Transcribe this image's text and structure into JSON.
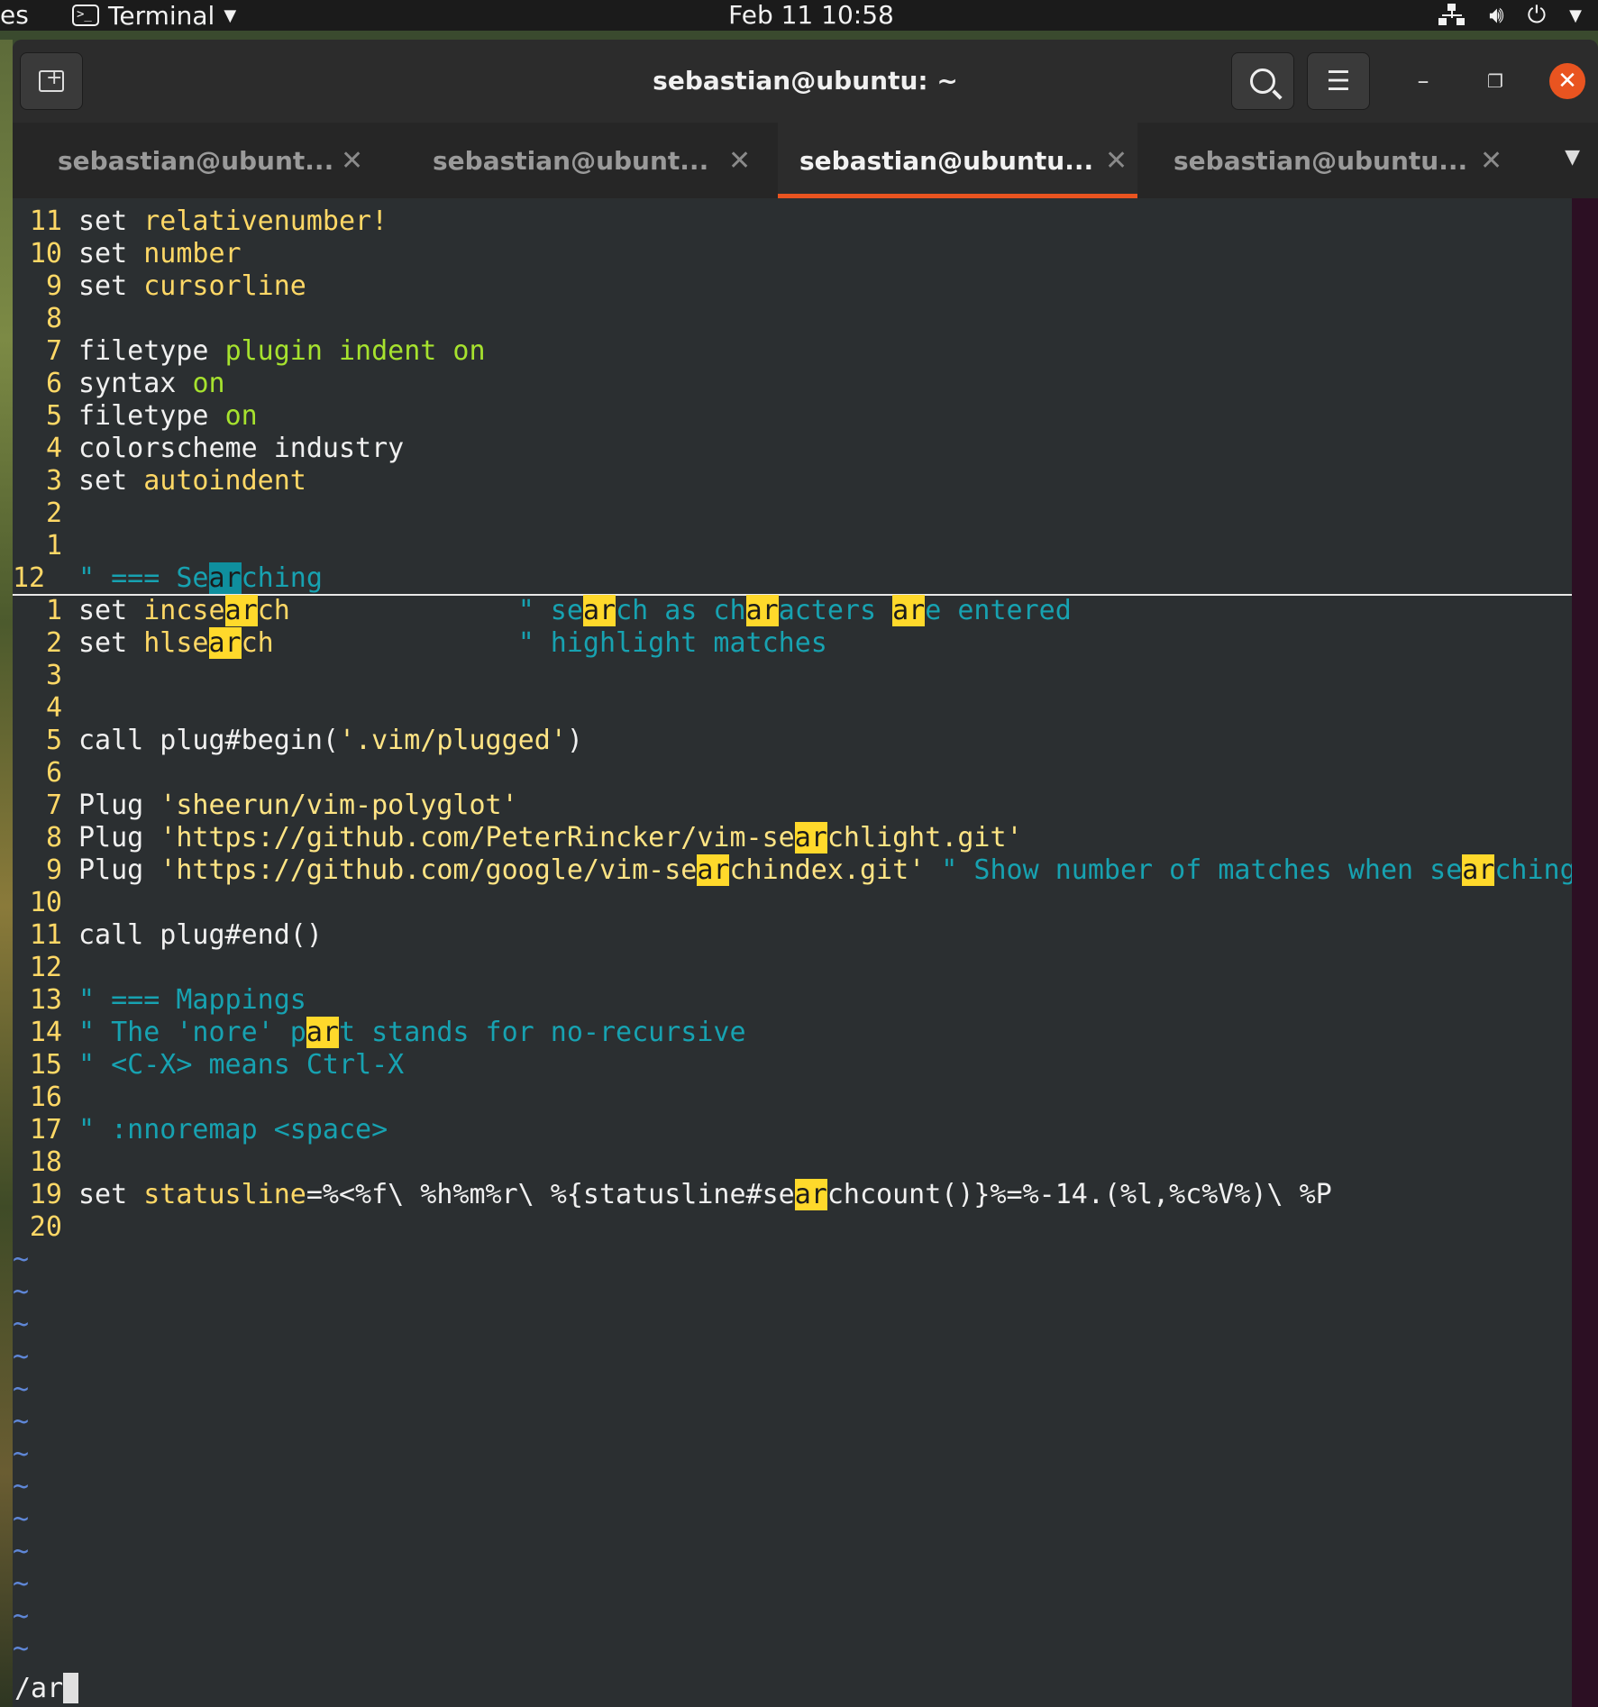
{
  "topbar": {
    "activities": "es",
    "app_name": "Terminal",
    "clock": "Feb 11  10:58"
  },
  "window": {
    "title": "sebastian@ubuntu: ~"
  },
  "tabs": [
    {
      "label": "sebastian@ubunt..."
    },
    {
      "label": "sebastian@ubunt..."
    },
    {
      "label": "sebastian@ubuntu..."
    },
    {
      "label": "sebastian@ubuntu..."
    }
  ],
  "vim": {
    "lines": [
      {
        "n": "11",
        "segs": [
          [
            "set ",
            "w"
          ],
          [
            "relativenumber!",
            "o"
          ]
        ]
      },
      {
        "n": "10",
        "segs": [
          [
            "set ",
            "w"
          ],
          [
            "number",
            "o"
          ]
        ]
      },
      {
        "n": "9",
        "segs": [
          [
            "set ",
            "w"
          ],
          [
            "cursorline",
            "o"
          ]
        ]
      },
      {
        "n": "8",
        "segs": []
      },
      {
        "n": "7",
        "segs": [
          [
            "filetype ",
            "w"
          ],
          [
            "plugin indent on",
            "g"
          ]
        ]
      },
      {
        "n": "6",
        "segs": [
          [
            "syntax ",
            "w"
          ],
          [
            "on",
            "g"
          ]
        ]
      },
      {
        "n": "5",
        "segs": [
          [
            "filetype ",
            "w"
          ],
          [
            "on",
            "g"
          ]
        ]
      },
      {
        "n": "4",
        "segs": [
          [
            "colorscheme ",
            "w"
          ],
          [
            "industry",
            "t"
          ]
        ]
      },
      {
        "n": "3",
        "segs": [
          [
            "set ",
            "w"
          ],
          [
            "autoindent",
            "o"
          ]
        ]
      },
      {
        "n": "2",
        "segs": []
      },
      {
        "n": "1",
        "segs": []
      },
      {
        "n": "12",
        "cur": true,
        "segs": [
          [
            "\" === Se",
            "c"
          ],
          [
            "ar",
            "hc"
          ],
          [
            "ching",
            "c"
          ]
        ]
      },
      {
        "n": "1",
        "segs": [
          [
            "set ",
            "w"
          ],
          [
            "incse",
            "o"
          ],
          [
            "ar",
            "h"
          ],
          [
            "ch",
            "o"
          ],
          [
            "              ",
            "w"
          ],
          [
            "\" se",
            "c"
          ],
          [
            "ar",
            "h"
          ],
          [
            "ch as ch",
            "c"
          ],
          [
            "ar",
            "h"
          ],
          [
            "acters ",
            "c"
          ],
          [
            "ar",
            "h"
          ],
          [
            "e entered",
            "c"
          ]
        ]
      },
      {
        "n": "2",
        "segs": [
          [
            "set ",
            "w"
          ],
          [
            "hlse",
            "o"
          ],
          [
            "ar",
            "h"
          ],
          [
            "ch",
            "o"
          ],
          [
            "               ",
            "w"
          ],
          [
            "\" highlight matches",
            "c"
          ]
        ]
      },
      {
        "n": "3",
        "segs": []
      },
      {
        "n": "4",
        "segs": []
      },
      {
        "n": "5",
        "segs": [
          [
            "call plug#begin(",
            "w"
          ],
          [
            "'.vim/plugged'",
            "s"
          ],
          [
            ")",
            "w"
          ]
        ]
      },
      {
        "n": "6",
        "segs": []
      },
      {
        "n": "7",
        "segs": [
          [
            "Plug ",
            "w"
          ],
          [
            "'sheerun/vim-polyglot'",
            "s"
          ]
        ]
      },
      {
        "n": "8",
        "segs": [
          [
            "Plug ",
            "w"
          ],
          [
            "'https://github.com/PeterRincker/vim-se",
            "s"
          ],
          [
            "ar",
            "h"
          ],
          [
            "chlight.git'",
            "s"
          ]
        ]
      },
      {
        "n": "9",
        "segs": [
          [
            "Plug ",
            "w"
          ],
          [
            "'https://github.com/google/vim-se",
            "s"
          ],
          [
            "ar",
            "h"
          ],
          [
            "chindex.git'",
            "s"
          ],
          [
            " \" Show number of matches when se",
            "c"
          ],
          [
            "ar",
            "h"
          ],
          [
            "ching",
            "c"
          ]
        ]
      },
      {
        "n": "10",
        "segs": []
      },
      {
        "n": "11",
        "segs": [
          [
            "call plug#end()",
            "w"
          ]
        ]
      },
      {
        "n": "12",
        "segs": []
      },
      {
        "n": "13",
        "segs": [
          [
            "\" === Mappings",
            "c"
          ]
        ]
      },
      {
        "n": "14",
        "segs": [
          [
            "\" The 'nore' p",
            "c"
          ],
          [
            "ar",
            "h"
          ],
          [
            "t stands for no-recursive",
            "c"
          ]
        ]
      },
      {
        "n": "15",
        "segs": [
          [
            "\" <C-X> means Ctrl-X",
            "c"
          ]
        ]
      },
      {
        "n": "16",
        "segs": []
      },
      {
        "n": "17",
        "segs": [
          [
            "\" :nnoremap <space>",
            "c"
          ]
        ]
      },
      {
        "n": "18",
        "segs": []
      },
      {
        "n": "19",
        "segs": [
          [
            "set ",
            "w"
          ],
          [
            "statusline",
            "o"
          ],
          [
            "=%<%f\\ %h%m%r\\ %{statusline#se",
            "w"
          ],
          [
            "ar",
            "h"
          ],
          [
            "chcount()}%=%-14.(%l,%c%V%)\\ %P",
            "w"
          ]
        ]
      },
      {
        "n": "20",
        "segs": []
      }
    ],
    "tilde_count": 13,
    "tilde": "~",
    "command_line": "/ar"
  },
  "colors": {
    "accent": "#e95420",
    "search_highlight": "#ffd92b",
    "current_match": "#0f8f9e"
  }
}
